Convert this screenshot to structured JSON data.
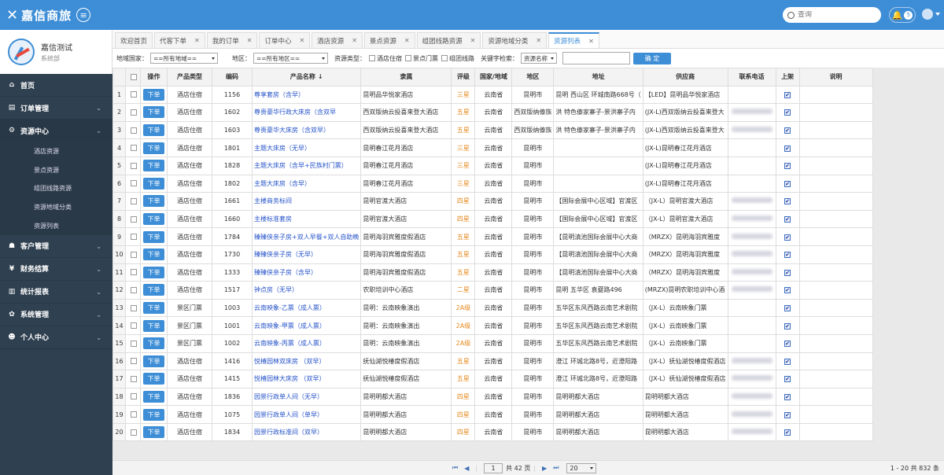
{
  "app": {
    "logo_mark": "✕",
    "title": "嘉信商旅",
    "menu_icon": "≡"
  },
  "header": {
    "search_placeholder": "查询",
    "notify_count": "5"
  },
  "profile": {
    "name": "嘉信测试",
    "role": "系统部"
  },
  "sidebar": {
    "items": [
      {
        "label": "首页",
        "icon": "home-icon",
        "glyph": "⌂",
        "chevron": false
      },
      {
        "label": "订单管理",
        "icon": "order-icon",
        "glyph": "▤",
        "chevron": true
      },
      {
        "label": "资源中心",
        "icon": "resource-icon",
        "glyph": "⚙",
        "chevron": true,
        "active": true
      },
      {
        "label": "客户管理",
        "icon": "customer-icon",
        "glyph": "☗",
        "chevron": true
      },
      {
        "label": "财务结算",
        "icon": "finance-icon",
        "glyph": "¥",
        "chevron": true
      },
      {
        "label": "统计报表",
        "icon": "report-icon",
        "glyph": "▥",
        "chevron": true
      },
      {
        "label": "系统管理",
        "icon": "system-icon",
        "glyph": "✿",
        "chevron": true
      },
      {
        "label": "个人中心",
        "icon": "person-icon",
        "glyph": "☻",
        "chevron": true
      }
    ],
    "sub_items": [
      "酒店资源",
      "景点资源",
      "组团线路资源",
      "资源地域分类",
      "资源列表"
    ]
  },
  "tabs": [
    {
      "label": "欢迎首页",
      "closable": false
    },
    {
      "label": "代客下单",
      "closable": true
    },
    {
      "label": "我的订单",
      "closable": true
    },
    {
      "label": "订单中心",
      "closable": true
    },
    {
      "label": "酒店资源",
      "closable": true
    },
    {
      "label": "景点资源",
      "closable": true
    },
    {
      "label": "组团线路资源",
      "closable": true
    },
    {
      "label": "资源地域分类",
      "closable": true
    },
    {
      "label": "资源列表",
      "closable": true,
      "active": true
    }
  ],
  "filters": {
    "country_label": "地域国家：",
    "country_value": "==所有地域==",
    "region_label": "地区：",
    "region_value": "==所有地区==",
    "type_label": "资源类型：",
    "type_options": [
      "酒店住宿",
      "景点门票",
      "组团线路"
    ],
    "keyword_label": "关键字检索：",
    "keyword_field": "资源名称",
    "ok_label": "确 定"
  },
  "table": {
    "columns": [
      "",
      "",
      "操作",
      "产品类型",
      "编码",
      "产品名称",
      "隶属",
      "评级",
      "国家/地域",
      "地区",
      "地址",
      "供应商",
      "联系电话",
      "上架",
      "说明"
    ],
    "sort_indicator": "↓",
    "order_label": "下单",
    "check_mark": "✔",
    "rows": [
      {
        "n": "1",
        "type": "酒店住宿",
        "code": "1156",
        "name": "尊享套房（含早）",
        "belong": "昆明品华悦家酒店",
        "grade": "三星",
        "country": "云南省",
        "area": "昆明市",
        "addr": "昆明 西山区 环城南路668号（",
        "supplier": "【LED】昆明品华悦家酒店",
        "phone": false
      },
      {
        "n": "2",
        "type": "酒店住宿",
        "code": "1602",
        "name": "尊贵豪华行政大床房（含双早",
        "belong": "西双版纳云投喜来登大酒店",
        "grade": "五星",
        "country": "云南省",
        "area": "西双版纳傣族",
        "addr": "洪 特色傣家寨子-景洪寨子内",
        "supplier": "(JX-L)西双版纳云投喜来登大",
        "phone": true
      },
      {
        "n": "3",
        "type": "酒店住宿",
        "code": "1603",
        "name": "尊贵豪华大床房（含双早）",
        "belong": "西双版纳云投喜来登大酒店",
        "grade": "五星",
        "country": "云南省",
        "area": "西双版纳傣族",
        "addr": "洪 特色傣家寨子-景洪寨子内",
        "supplier": "(JX-L)西双版纳云投喜来登大",
        "phone": true
      },
      {
        "n": "4",
        "type": "酒店住宿",
        "code": "1801",
        "name": "主题大床房（无早）",
        "belong": "昆明春江花月酒店",
        "grade": "三星",
        "country": "云南省",
        "area": "昆明市",
        "addr": "",
        "supplier": "(JX-L)昆明春江花月酒店",
        "phone": false
      },
      {
        "n": "5",
        "type": "酒店住宿",
        "code": "1828",
        "name": "主题大床房（含早+民族村门票）",
        "belong": "昆明春江花月酒店",
        "grade": "三星",
        "country": "云南省",
        "area": "昆明市",
        "addr": "",
        "supplier": "(JX-L)昆明春江花月酒店",
        "phone": false
      },
      {
        "n": "6",
        "type": "酒店住宿",
        "code": "1802",
        "name": "主题大床房（含早）",
        "belong": "昆明春江花月酒店",
        "grade": "三星",
        "country": "云南省",
        "area": "昆明市",
        "addr": "",
        "supplier": "(JX-L)昆明春江花月酒店",
        "phone": false
      },
      {
        "n": "7",
        "type": "酒店住宿",
        "code": "1661",
        "name": "主楼商务标间",
        "belong": "昆明官渡大酒店",
        "grade": "四星",
        "country": "云南省",
        "area": "昆明市",
        "addr": "【国际会展中心区域】官渡区",
        "supplier": "（JX-L）昆明官渡大酒店",
        "phone": true
      },
      {
        "n": "8",
        "type": "酒店住宿",
        "code": "1660",
        "name": "主楼标准套房",
        "belong": "昆明官渡大酒店",
        "grade": "四星",
        "country": "云南省",
        "area": "昆明市",
        "addr": "【国际会展中心区域】官渡区",
        "supplier": "（JX-L）昆明官渡大酒店",
        "phone": true
      },
      {
        "n": "9",
        "type": "酒店住宿",
        "code": "1784",
        "name": "臻臻侠亲子房+双人早餐+双人自助晚",
        "belong": "昆明海羽宾雅度假酒店",
        "grade": "五星",
        "country": "云南省",
        "area": "昆明市",
        "addr": "【昆明滇池国际会展中心大商",
        "supplier": "（MRZX）昆明海羽宾雅度",
        "phone": true
      },
      {
        "n": "10",
        "type": "酒店住宿",
        "code": "1730",
        "name": "臻臻侠亲子房（无早）",
        "belong": "昆明海羽宾雅度假酒店",
        "grade": "五星",
        "country": "云南省",
        "area": "昆明市",
        "addr": "【昆明滇池国际会展中心大商",
        "supplier": "（MRZX）昆明海羽宾雅度",
        "phone": true
      },
      {
        "n": "11",
        "type": "酒店住宿",
        "code": "1333",
        "name": "臻臻侠亲子房（含早）",
        "belong": "昆明海羽宾雅度假酒店",
        "grade": "五星",
        "country": "云南省",
        "area": "昆明市",
        "addr": "【昆明滇池国际会展中心大商",
        "supplier": "（MRZX）昆明海羽宾雅度",
        "phone": true
      },
      {
        "n": "12",
        "type": "酒店住宿",
        "code": "1517",
        "name": "钟点房（无早）",
        "belong": "农职培训中心酒店",
        "grade": "二星",
        "country": "云南省",
        "area": "昆明市",
        "addr": "昆明 五华区 袁夔路496",
        "supplier": "(MRZX)昆明农职培训中心酒",
        "phone": true
      },
      {
        "n": "13",
        "type": "景区门票",
        "code": "1003",
        "name": "云南映象-乙票（成人票）",
        "belong": "昆明：云南映象演出",
        "grade": "2A级",
        "country": "云南省",
        "area": "昆明市",
        "addr": "五华区东风西路云南艺术剧院",
        "supplier": "（JX-L）云南映象门票",
        "phone": false
      },
      {
        "n": "14",
        "type": "景区门票",
        "code": "1001",
        "name": "云南映象-甲票（成人票）",
        "belong": "昆明：云南映象演出",
        "grade": "2A级",
        "country": "云南省",
        "area": "昆明市",
        "addr": "五华区东风西路云南艺术剧院",
        "supplier": "（JX-L）云南映象门票",
        "phone": false
      },
      {
        "n": "15",
        "type": "景区门票",
        "code": "1002",
        "name": "云南映象-丙票（成人票）",
        "belong": "昆明：云南映象演出",
        "grade": "2A级",
        "country": "云南省",
        "area": "昆明市",
        "addr": "五华区东风西路云南艺术剧院",
        "supplier": "（JX-L）云南映象门票",
        "phone": false
      },
      {
        "n": "16",
        "type": "酒店住宿",
        "code": "1416",
        "name": "悦椿园林双床房 （双早）",
        "belong": "抚仙湖悦椿度假酒店",
        "grade": "五星",
        "country": "云南省",
        "area": "昆明市",
        "addr": "澄江 环城北路8号，近澄阳路",
        "supplier": "（JX-L）抚仙湖悦椿度假酒店",
        "phone": true
      },
      {
        "n": "17",
        "type": "酒店住宿",
        "code": "1415",
        "name": "悦椿园林大床房 （双早）",
        "belong": "抚仙湖悦椿度假酒店",
        "grade": "五星",
        "country": "云南省",
        "area": "昆明市",
        "addr": "澄江 环城北路8号，近澄阳路",
        "supplier": "（JX-L）抚仙湖悦椿度假酒店",
        "phone": true
      },
      {
        "n": "18",
        "type": "酒店住宿",
        "code": "1836",
        "name": "园景行政单人间（无早）",
        "belong": "昆明明都大酒店",
        "grade": "四星",
        "country": "云南省",
        "area": "昆明市",
        "addr": "昆明明都大酒店",
        "supplier": "昆明明都大酒店",
        "phone": true
      },
      {
        "n": "19",
        "type": "酒店住宿",
        "code": "1075",
        "name": "园景行政单人间（单早）",
        "belong": "昆明明都大酒店",
        "grade": "四星",
        "country": "云南省",
        "area": "昆明市",
        "addr": "昆明明都大酒店",
        "supplier": "昆明明都大酒店",
        "phone": true
      },
      {
        "n": "20",
        "type": "酒店住宿",
        "code": "1834",
        "name": "园景行政标准间（双早）",
        "belong": "昆明明都大酒店",
        "grade": "四星",
        "country": "云南省",
        "area": "昆明市",
        "addr": "昆明明都大酒店",
        "supplier": "昆明明都大酒店",
        "phone": true
      }
    ]
  },
  "pager": {
    "first": "⏮",
    "prev": "◀",
    "next": "▶",
    "last": "⏭",
    "page": "1",
    "total_pages_text": "共 42 页",
    "page_size": "20",
    "summary": "1 - 20  共 832 条"
  },
  "colors": {
    "accent": "#3d8ed6",
    "sidebar": "#2f4050",
    "grade": "#e58a1f",
    "link": "#2653c9"
  }
}
